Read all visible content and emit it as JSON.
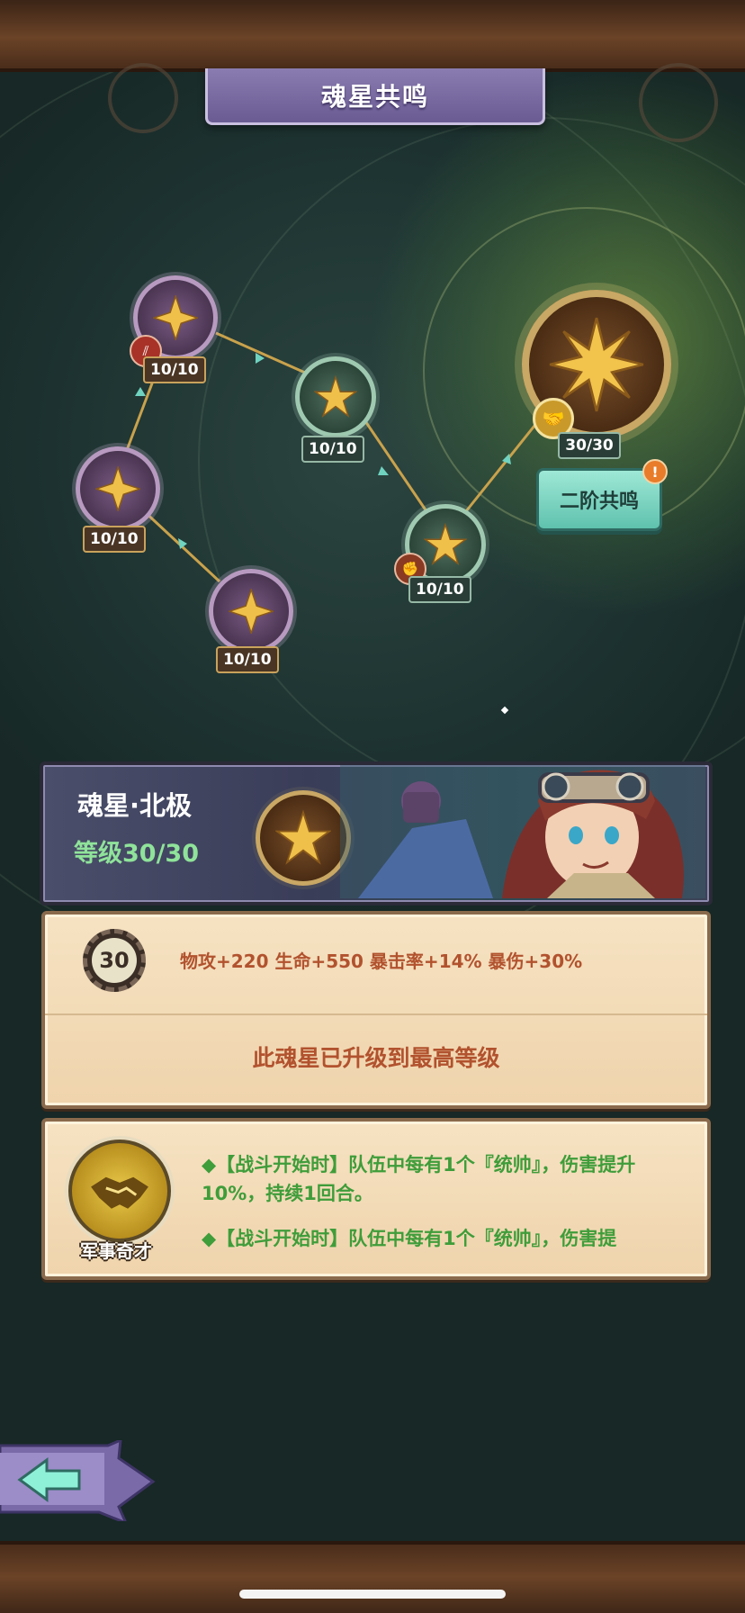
{
  "title": "魂星共鸣",
  "nodes": [
    {
      "id": "n1",
      "level": "10/10",
      "style": "purple"
    },
    {
      "id": "n2",
      "level": "10/10",
      "style": "purple"
    },
    {
      "id": "n3",
      "level": "10/10",
      "style": "purple"
    },
    {
      "id": "n4",
      "level": "10/10",
      "style": "teal"
    },
    {
      "id": "n5",
      "level": "10/10",
      "style": "teal"
    },
    {
      "id": "n6",
      "level": "30/30",
      "style": "big"
    }
  ],
  "second_resonance_button": "二阶共鸣",
  "alert_mark": "!",
  "info": {
    "star_name": "魂星·北极",
    "level_text": "等级30/30"
  },
  "attributes": {
    "level_number": "30",
    "stats": "物攻+220 生命+550 暴击率+14% 暴伤+30%",
    "max_message": "此魂星已升级到最高等级"
  },
  "skill": {
    "name": "军事奇才",
    "line1": "◆【战斗开始时】队伍中每有1个『统帅』，伤害提升10%，持续1回合。",
    "line2": "◆【战斗开始时】队伍中每有1个『统帅』，伤害提"
  },
  "colors": {
    "accent_gold": "#e6b43c",
    "level_green": "#8fe39a",
    "stat_red": "#b2522e",
    "skill_green": "#3f9d3a",
    "button_teal": "#7fd8c4"
  },
  "icons": {
    "node_icon": "four-point-star-icon",
    "big_node_icon": "eight-point-star-icon",
    "handshake": "handshake-icon",
    "back": "back-arrow-icon"
  }
}
